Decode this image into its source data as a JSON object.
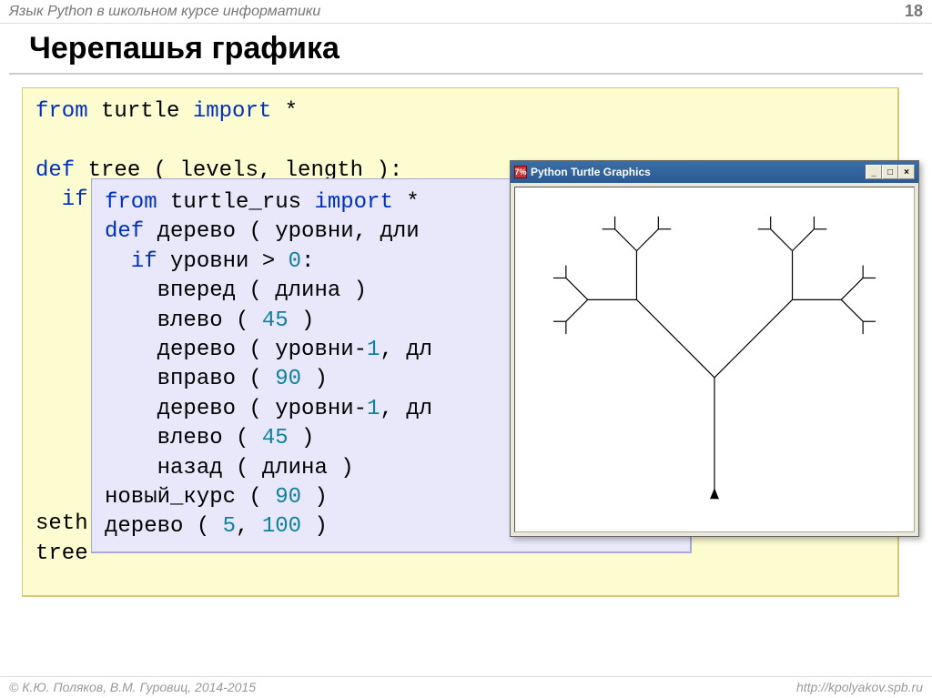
{
  "header": {
    "subtitle": "Язык Python в школьном курсе информатики",
    "page": "18"
  },
  "title": "Черепашья графика",
  "code_eng": {
    "l1a": "from",
    "l1b": " turtle ",
    "l1c": "import",
    "l1d": " *",
    "l3a": "def",
    "l3b": " tree ( levels, length ):",
    "l4a": "  if",
    "lSet": "seth",
    "lTree": "tree"
  },
  "code_rus": {
    "l1a": "from",
    "l1b": " turtle_rus ",
    "l1c": "import",
    "l1d": " *",
    "l2a": "def",
    "l2b": " дерево ( уровни, дли",
    "l3a": "  if",
    "l3b": " уровни > ",
    "l3c": "0",
    "l3d": ":",
    "l4": "    вперед ( длина )",
    "l5a": "    влево ( ",
    "l5b": "45",
    "l5c": " )",
    "l6a": "    дерево ( уровни-",
    "l6b": "1",
    "l6c": ", дл",
    "l7a": "    вправо ( ",
    "l7b": "90",
    "l7c": " )",
    "l8a": "    дерево ( уровни-",
    "l8b": "1",
    "l8c": ", дл",
    "l9a": "    влево ( ",
    "l9b": "45",
    "l9c": " )",
    "l10": "    назад ( длина )",
    "l11a": "новый_курс ( ",
    "l11b": "90",
    "l11c": " )",
    "l12a": "дерево ( ",
    "l12b": "5",
    "l12c": ", ",
    "l12d": "100",
    "l12e": " )"
  },
  "turtle_window": {
    "tk": "7%",
    "title": "Python Turtle Graphics"
  },
  "footer": {
    "left": "© К.Ю. Поляков, В.М. Гуровиц, 2014-2015",
    "right": "http://kpolyakov.spb.ru"
  }
}
